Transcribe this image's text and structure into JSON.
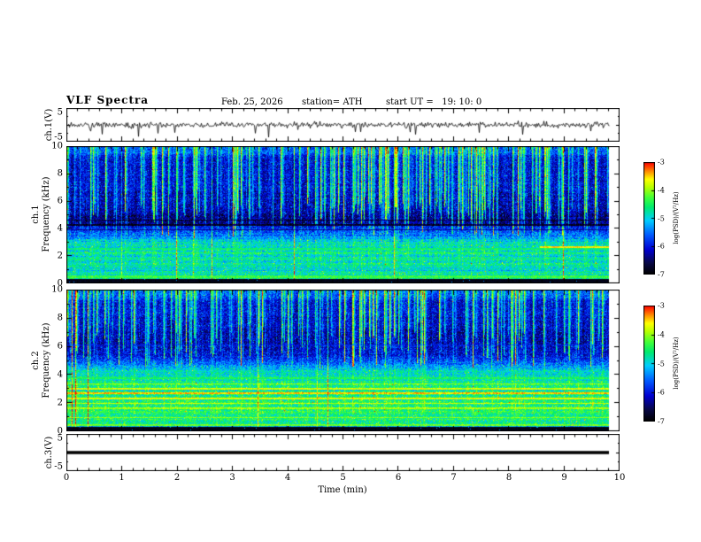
{
  "header": {
    "title": "VLF Spectra",
    "date": "Feb. 25, 2026",
    "station": "station= ATH",
    "start_ut": "start UT =   19: 10: 0"
  },
  "xaxis": {
    "label": "Time (min)",
    "ticks": [
      "0",
      "1",
      "2",
      "3",
      "4",
      "5",
      "6",
      "7",
      "8",
      "9",
      "10"
    ]
  },
  "colorbar": {
    "label": "log(PSD)/(V²/Hz)",
    "ticks": [
      "-3",
      "-4",
      "-5",
      "-6",
      "-7"
    ],
    "colors_top_to_bottom": [
      "#ff0000",
      "#ff8c00",
      "#ffff00",
      "#00ff00",
      "#00ffff",
      "#0000ff",
      "#000000"
    ]
  },
  "chart_data": [
    {
      "type": "line",
      "name": "ch1-waveform",
      "ylabel": "ch.1(V)",
      "xlim": [
        0,
        10
      ],
      "ylim": [
        -5,
        5
      ],
      "yticks": [
        5,
        -5
      ],
      "x_end": 9.8,
      "noise_amp": 0.8,
      "spike_rate": 0.025,
      "spike_amp": 2.2,
      "description": "broadband noise trace about 0 V, ~±1.5 V, occasional negative spikes to ~-4 V"
    },
    {
      "type": "heatmap",
      "name": "ch1-spectrogram",
      "ylabel_lines": [
        "ch.1",
        "Frequency (kHz)"
      ],
      "xlim": [
        0,
        10
      ],
      "ylim": [
        0,
        10
      ],
      "yticks": [
        0,
        2,
        4,
        6,
        8,
        10
      ],
      "zlim": [
        -7,
        -3
      ],
      "x_end": 9.8,
      "streak_minF": 3.3,
      "profile": [
        [
          0,
          -6.95
        ],
        [
          0.3,
          -6.95
        ],
        [
          0.32,
          -4.7
        ],
        [
          0.6,
          -4.8
        ],
        [
          0.9,
          -4.95
        ],
        [
          2.8,
          -4.95
        ],
        [
          3.1,
          -5.2
        ],
        [
          3.5,
          -5.55
        ],
        [
          4.1,
          -6.1
        ],
        [
          4.4,
          -6.55
        ],
        [
          4.9,
          -6.6
        ],
        [
          5.3,
          -6.35
        ],
        [
          9.2,
          -6.35
        ],
        [
          9.5,
          -5.95
        ],
        [
          10,
          -5.85
        ]
      ],
      "hlines": [
        {
          "f": 0.45,
          "w": 0.14,
          "level": -4.35
        },
        {
          "f": 1.3,
          "w": 0.08,
          "level": -4.75
        },
        {
          "f": 1.75,
          "w": 0.08,
          "level": -4.7
        },
        {
          "f": 2.2,
          "w": 0.1,
          "level": -4.55
        },
        {
          "f": 2.5,
          "w": 0.08,
          "level": -4.6
        },
        {
          "f": 3.9,
          "w": 0.1,
          "level": -6.4
        },
        {
          "f": 4.25,
          "w": 0.12,
          "level": -6.85
        },
        {
          "f": 4.6,
          "w": 0.1,
          "level": -6.8
        }
      ],
      "segments": [
        {
          "t0": 8.55,
          "t1": 9.8,
          "f": 2.62,
          "w": 0.14,
          "level": -3.55
        }
      ],
      "description": "VLF spectrogram ch.1: dark-blue band 4-10 kHz crossed by dense green vertical sferic streaks; green/cyan mottled band 0.5-3.2 kHz with horizontal lines; black band below 0.3 kHz; orange streak near 2.6 kHz after t=8.5 min"
    },
    {
      "type": "heatmap",
      "name": "ch2-spectrogram",
      "ylabel_lines": [
        "ch.2",
        "Frequency (kHz)"
      ],
      "xlim": [
        0,
        10
      ],
      "ylim": [
        0,
        10
      ],
      "yticks": [
        0,
        2,
        4,
        6,
        8,
        10
      ],
      "zlim": [
        -7,
        -3
      ],
      "x_end": 9.8,
      "streak_minF": 4.4,
      "profile": [
        [
          0,
          -6.95
        ],
        [
          0.3,
          -6.95
        ],
        [
          0.32,
          -4.4
        ],
        [
          0.6,
          -4.7
        ],
        [
          3.4,
          -4.8
        ],
        [
          4.3,
          -5.1
        ],
        [
          4.8,
          -5.7
        ],
        [
          5.4,
          -6.2
        ],
        [
          6.6,
          -6.4
        ],
        [
          9.2,
          -6.3
        ],
        [
          9.5,
          -5.95
        ],
        [
          10,
          -5.85
        ]
      ],
      "hlines": [
        {
          "f": 0.4,
          "w": 0.12,
          "level": -4.15
        },
        {
          "f": 0.95,
          "w": 0.1,
          "level": -4.1
        },
        {
          "f": 1.3,
          "w": 0.08,
          "level": -4.4
        },
        {
          "f": 1.6,
          "w": 0.1,
          "level": -4.0
        },
        {
          "f": 1.95,
          "w": 0.1,
          "level": -3.85
        },
        {
          "f": 2.3,
          "w": 0.1,
          "level": -3.75
        },
        {
          "f": 2.65,
          "w": 0.12,
          "level": -3.5
        },
        {
          "f": 3.0,
          "w": 0.1,
          "level": -3.8
        },
        {
          "f": 3.35,
          "w": 0.08,
          "level": -4.1
        },
        {
          "f": 3.75,
          "w": 0.08,
          "level": -4.5
        },
        {
          "f": 4.2,
          "w": 0.08,
          "level": -4.8
        },
        {
          "f": 6.1,
          "w": 0.08,
          "level": -6.0
        }
      ],
      "segments": [],
      "description": "VLF spectrogram ch.2: dark-blue band 5-10 kHz with vertical sferic streaks; strong yellow/orange/red horizontal power-line harmonics 0.4-4.2 kHz over green background; black band below 0.3 kHz"
    },
    {
      "type": "line",
      "name": "ch3-waveform",
      "ylabel": "ch.3(V)",
      "xlim": [
        0,
        10
      ],
      "ylim": [
        -5,
        5
      ],
      "yticks": [
        5,
        -5
      ],
      "x_end": 9.8,
      "flat_value": 0,
      "description": "flat thick black line at 0 V (channel inactive)"
    }
  ]
}
